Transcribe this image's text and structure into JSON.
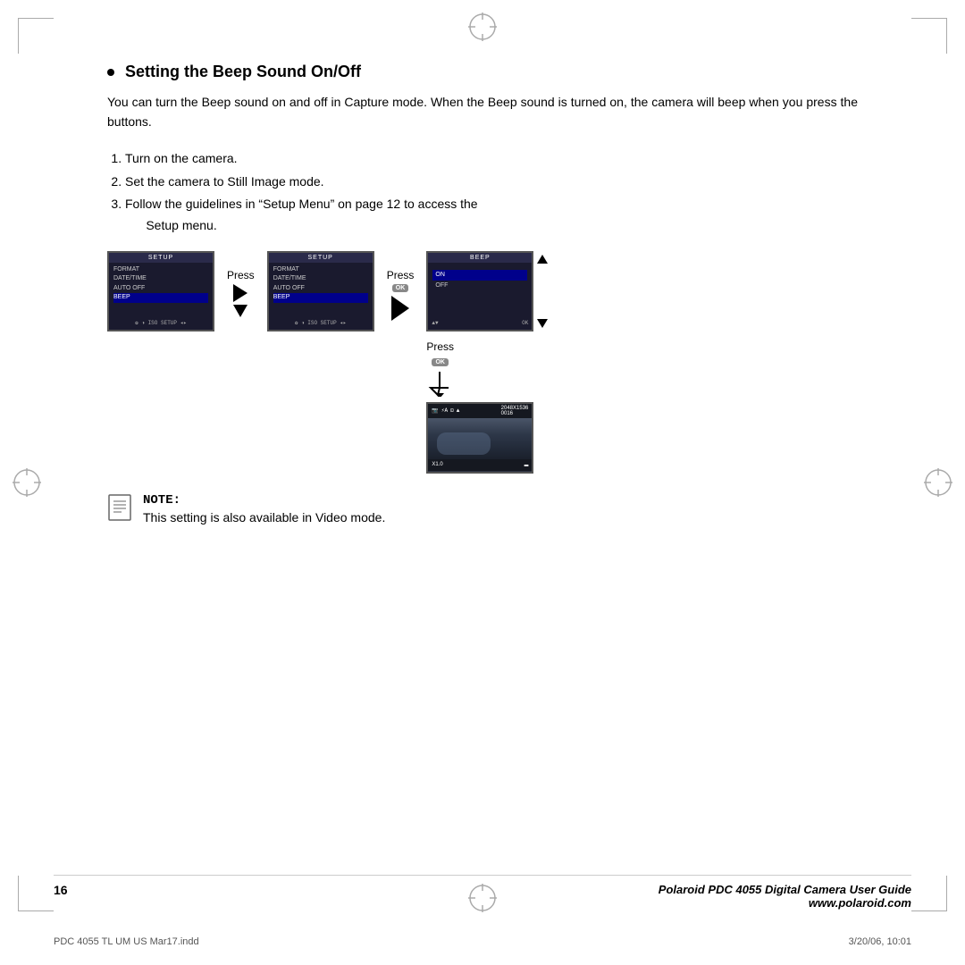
{
  "page": {
    "title": "Setting the Beep Sound On/Off",
    "body_text": "You can turn the Beep sound on and off in Capture mode. When the Beep sound is turned on, the camera will beep when you press the buttons.",
    "steps": [
      "Turn on the camera.",
      "Set the camera to Still Image mode.",
      "Follow the guidelines in “Setup Menu” on page 12 to access the Setup menu."
    ],
    "step3_line2": "Setup menu."
  },
  "diagram": {
    "screen1": {
      "header": "SETUP",
      "items": [
        "FORMAT",
        "DATE/TIME",
        "AUTO OFF",
        "BEEP"
      ],
      "highlighted": "BEEP"
    },
    "screen2": {
      "header": "SETUP",
      "items": [
        "FORMAT",
        "DATE/TIME",
        "AUTO OFF",
        "BEEP"
      ],
      "highlighted": "BEEP"
    },
    "screen3": {
      "header": "BEEP",
      "items": [
        "ON",
        "OFF"
      ],
      "highlighted": "ON"
    },
    "press1": "Press",
    "press2": "Press",
    "press3": "Press",
    "ok_label": "OK",
    "camera_preview": {
      "resolution": "2048X1536",
      "number": "0016",
      "zoom": "X1.0"
    }
  },
  "note": {
    "label": "NOTE:",
    "text": "This setting is also available in Video mode."
  },
  "footer": {
    "page_number": "16",
    "guide_title": "Polaroid PDC 4055 Digital Camera User Guide",
    "website": "www.polaroid.com",
    "file_info": "PDC 4055 TL UM US Mar17.indd",
    "date_info": "3/20/06, 10:01"
  }
}
